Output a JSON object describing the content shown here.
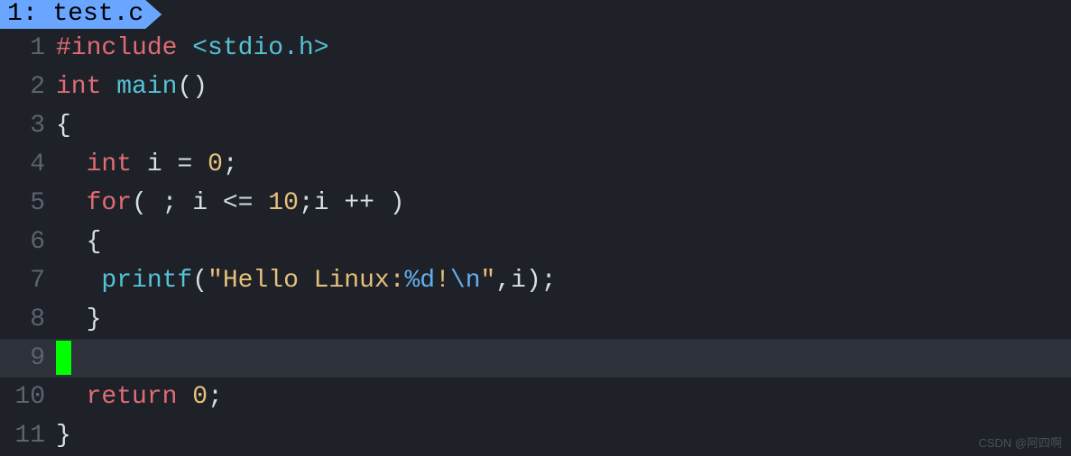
{
  "tab": {
    "index": "1",
    "filename": "test.c"
  },
  "code": {
    "current_line": 9,
    "lines": [
      {
        "n": "1",
        "tokens": [
          {
            "t": "#include",
            "c": "kw-preproc"
          },
          {
            "t": " ",
            "c": ""
          },
          {
            "t": "<stdio.h>",
            "c": "angle"
          }
        ]
      },
      {
        "n": "2",
        "tokens": [
          {
            "t": "int",
            "c": "kw-type"
          },
          {
            "t": " ",
            "c": ""
          },
          {
            "t": "main",
            "c": "fn"
          },
          {
            "t": "()",
            "c": "paren"
          }
        ]
      },
      {
        "n": "3",
        "tokens": [
          {
            "t": "{",
            "c": "brace"
          }
        ]
      },
      {
        "n": "4",
        "tokens": [
          {
            "t": "  ",
            "c": ""
          },
          {
            "t": "int",
            "c": "kw-type"
          },
          {
            "t": " i ",
            "c": "ident"
          },
          {
            "t": "=",
            "c": "op"
          },
          {
            "t": " ",
            "c": ""
          },
          {
            "t": "0",
            "c": "num"
          },
          {
            "t": ";",
            "c": "semi"
          }
        ]
      },
      {
        "n": "5",
        "tokens": [
          {
            "t": "  ",
            "c": ""
          },
          {
            "t": "for",
            "c": "kw-stmt"
          },
          {
            "t": "( ; i ",
            "c": "paren"
          },
          {
            "t": "<=",
            "c": "op"
          },
          {
            "t": " ",
            "c": ""
          },
          {
            "t": "10",
            "c": "num"
          },
          {
            "t": ";i ",
            "c": "ident"
          },
          {
            "t": "++",
            "c": "op"
          },
          {
            "t": " )",
            "c": "paren"
          }
        ]
      },
      {
        "n": "6",
        "tokens": [
          {
            "t": "  {",
            "c": "brace"
          }
        ]
      },
      {
        "n": "7",
        "tokens": [
          {
            "t": "   ",
            "c": ""
          },
          {
            "t": "printf",
            "c": "fn"
          },
          {
            "t": "(",
            "c": "paren"
          },
          {
            "t": "\"Hello Linux:",
            "c": "str"
          },
          {
            "t": "%d",
            "c": "fmt"
          },
          {
            "t": "!",
            "c": "str"
          },
          {
            "t": "\\n",
            "c": "esc"
          },
          {
            "t": "\"",
            "c": "str"
          },
          {
            "t": ",i);",
            "c": "paren"
          }
        ]
      },
      {
        "n": "8",
        "tokens": [
          {
            "t": "  }",
            "c": "brace"
          }
        ]
      },
      {
        "n": "9",
        "tokens": []
      },
      {
        "n": "10",
        "tokens": [
          {
            "t": "  ",
            "c": ""
          },
          {
            "t": "return",
            "c": "kw-stmt"
          },
          {
            "t": " ",
            "c": ""
          },
          {
            "t": "0",
            "c": "num"
          },
          {
            "t": ";",
            "c": "semi"
          }
        ]
      },
      {
        "n": "11",
        "tokens": [
          {
            "t": "}",
            "c": "brace"
          }
        ]
      }
    ]
  },
  "watermark": "CSDN @阿四啊"
}
